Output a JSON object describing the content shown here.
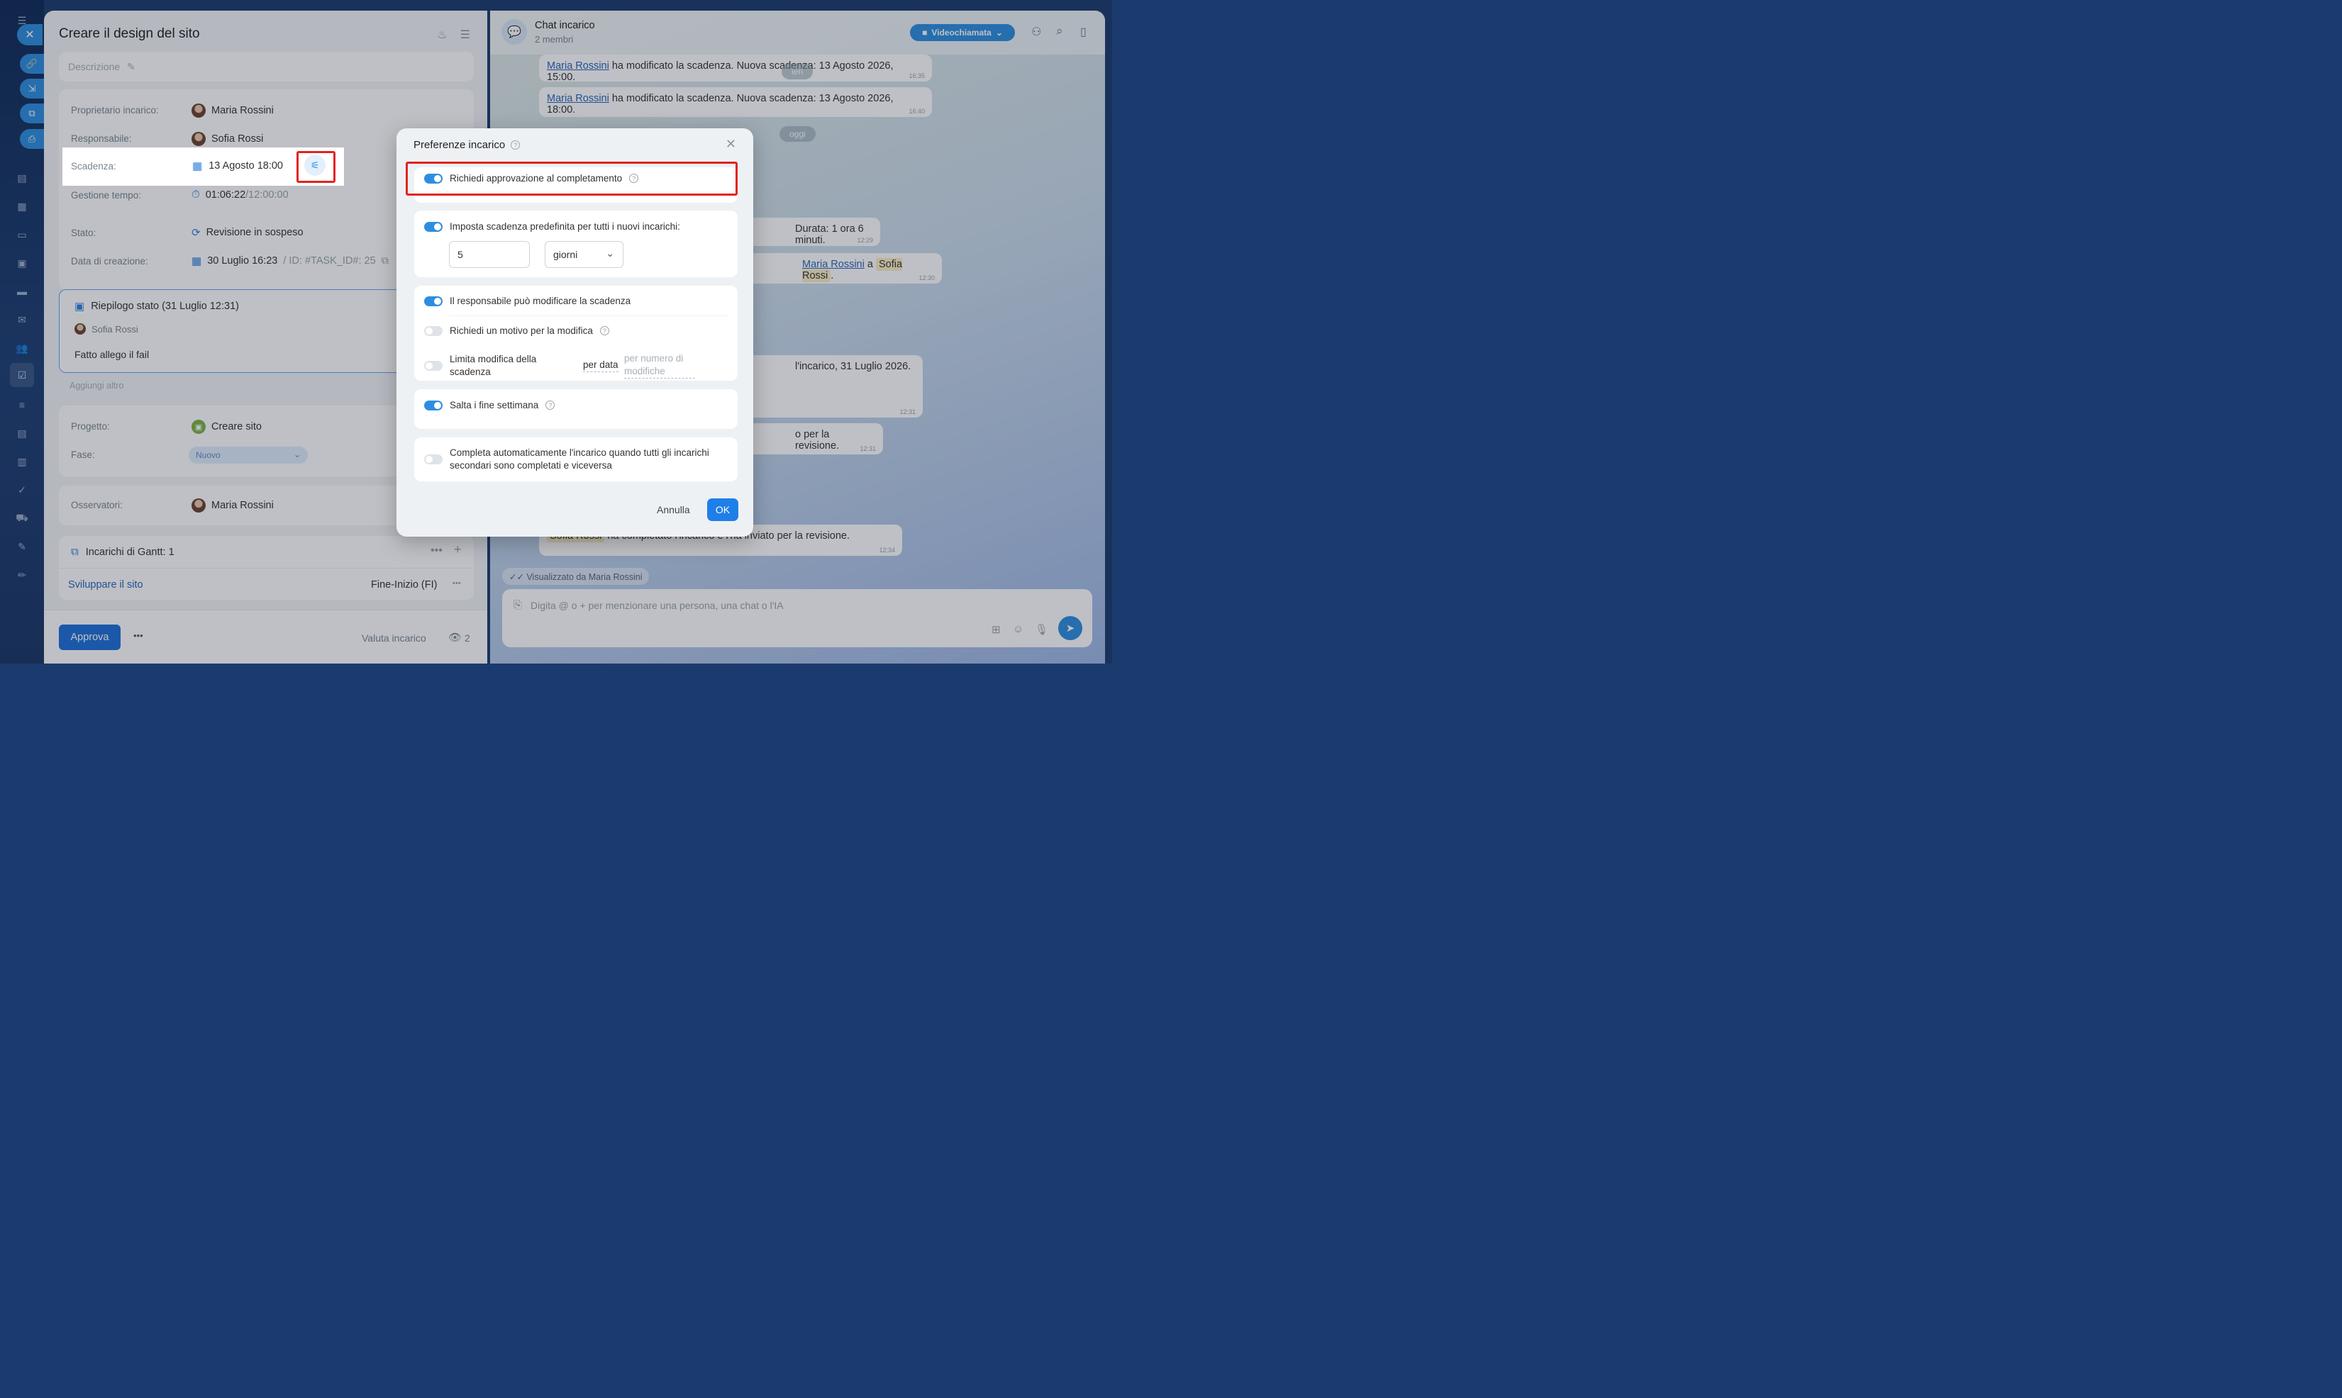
{
  "task": {
    "title": "Creare il design del sito",
    "description_placeholder": "Descrizione",
    "owner_label": "Proprietario incarico:",
    "owner": "Maria Rossini",
    "responsible_label": "Responsabile:",
    "responsible": "Sofia Rossi",
    "deadline_label": "Scadenza:",
    "deadline": "13 Agosto 18:00",
    "time_label": "Gestione tempo:",
    "time_spent": "01:06:22",
    "time_total": "/12:00:00",
    "status_label": "Stato:",
    "status": "Revisione in sospeso",
    "created_label": "Data di creazione:",
    "created": "30 Luglio 16:23",
    "task_id": "/  ID: #TASK_ID#: 25",
    "summary_title": "Riepilogo stato (31 Luglio 12:31)",
    "summary_author": "Sofia Rossi",
    "summary_text": "Fatto allego il fail",
    "add_more": "Aggiungi altro",
    "project_label": "Progetto:",
    "project": "Creare sito",
    "phase_label": "Fase:",
    "phase": "Nuovo",
    "observers_label": "Osservatori:",
    "observer": "Maria Rossini",
    "gantt_title": "Incarichi di Gantt: 1",
    "gantt_item": "Sviluppare il sito",
    "gantt_type": "Fine-Inizio (FI)",
    "approve_button": "Approva",
    "rate_task": "Valuta incarico",
    "views_count": "2"
  },
  "chat": {
    "title": "Chat incarico",
    "members": "2 membri",
    "video_button": "Videochiamata",
    "date_ieri": "ieri",
    "date_oggi": "oggi",
    "messages": [
      {
        "user": "Maria Rossini",
        "text": " ha modificato la scadenza. Nuova scadenza: 13 Agosto 2026, 15:00.",
        "time": "16:35"
      },
      {
        "user": "Maria Rossini",
        "text": " ha modificato la scadenza. Nuova scadenza: 13 Agosto 2026, 18:00.",
        "time": "16:40"
      },
      {
        "text": "Durata: 1 ora 6 minuti.",
        "time": "12:29"
      },
      {
        "user": "Maria Rossini",
        "mid": " a ",
        "user2": "Sofia Rossi",
        "end": ".",
        "time": "12:30"
      },
      {
        "text": "l'incarico, 31 Luglio 2026.",
        "time": "12:31"
      },
      {
        "text": "o per la revisione.",
        "time": "12:31"
      },
      {
        "user": "Sofia Rossi",
        "text": " ha completato l'incarico e l'ha inviato per la revisione.",
        "time": "12:34"
      }
    ],
    "seen": "Visualizzato da Maria Rossini",
    "input_placeholder": "Digita @ o + per menzionare una persona, una chat o l'IA"
  },
  "modal": {
    "title": "Preferenze incarico",
    "opt_approval": "Richiedi approvazione al completamento",
    "opt_default_deadline": "Imposta scadenza predefinita per tutti i nuovi incarichi:",
    "default_deadline_value": "5",
    "default_deadline_unit": "giorni",
    "opt_responsible_edit": "Il responsabile può modificare la scadenza",
    "opt_require_reason": "Richiedi un motivo per la modifica",
    "opt_limit_edit": "Limita modifica della scadenza",
    "limit_by_date": "per data",
    "limit_by_count": "per numero di modifiche",
    "opt_skip_weekends": "Salta i fine settimana",
    "opt_auto_complete": "Completa automaticamente l'incarico quando tutti gli incarichi secondari sono completati e viceversa",
    "cancel_button": "Annulla",
    "ok_button": "OK"
  }
}
